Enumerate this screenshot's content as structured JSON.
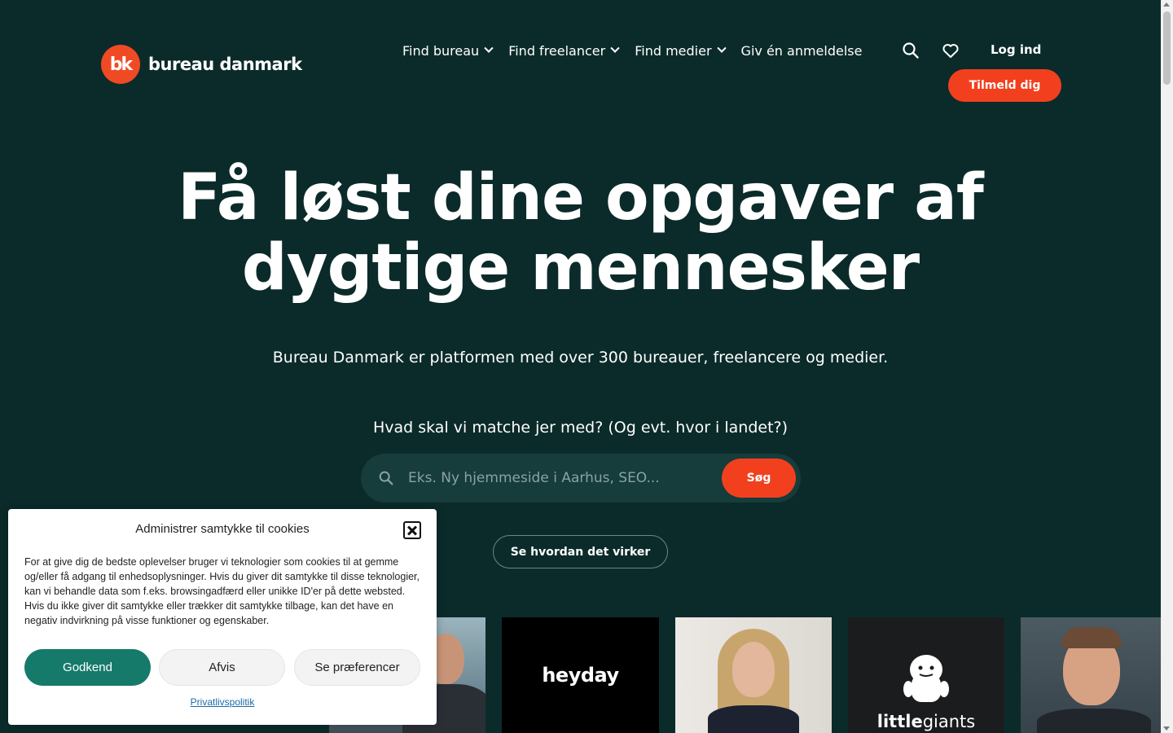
{
  "brand": {
    "logo_mark": "bk",
    "name": "bureau danmark",
    "accent": "#f2401f",
    "background": "#0b2b2a"
  },
  "nav": {
    "items": [
      {
        "label": "Find bureau",
        "has_dropdown": true
      },
      {
        "label": "Find freelancer",
        "has_dropdown": true
      },
      {
        "label": "Find medier",
        "has_dropdown": true
      },
      {
        "label": "Giv én anmeldelse",
        "has_dropdown": false
      }
    ],
    "search_icon": "search-icon",
    "favorites_icon": "heart-icon",
    "login_label": "Log ind",
    "signup_label": "Tilmeld dig"
  },
  "hero": {
    "title_line1": "Få løst dine opgaver af",
    "title_line2": "dygtige mennesker",
    "subtitle": "Bureau Danmark er platformen med over 300 bureauer, freelancere og medier.",
    "match_question": "Hvad skal vi matche jer med? (Og evt. hvor i landet?)",
    "search_placeholder": "Eks. Ny hjemmeside i Aarhus, SEO...",
    "search_button": "Søg",
    "how_button": "Se hvordan det virker"
  },
  "cards": {
    "heyday_logo": "heyday",
    "littlegiants_logo_a": "little",
    "littlegiants_logo_b": "giants"
  },
  "cookie": {
    "title": "Administrer samtykke til cookies",
    "body": "For at give dig de bedste oplevelser bruger vi teknologier som cookies til at gemme og/eller få adgang til enhedsoplysninger. Hvis du giver dit samtykke til disse teknologier, kan vi behandle data som f.eks. browsingadfærd eller unikke ID'er på dette websted. Hvis du ikke giver dit samtykke eller trækker dit samtykke tilbage, kan det have en negativ indvirkning på visse funktioner og egenskaber.",
    "accept_label": "Godkend",
    "deny_label": "Afvis",
    "prefs_label": "Se præferencer",
    "privacy_label": "Privatlivspolitik",
    "accept_color": "#167a6b"
  }
}
